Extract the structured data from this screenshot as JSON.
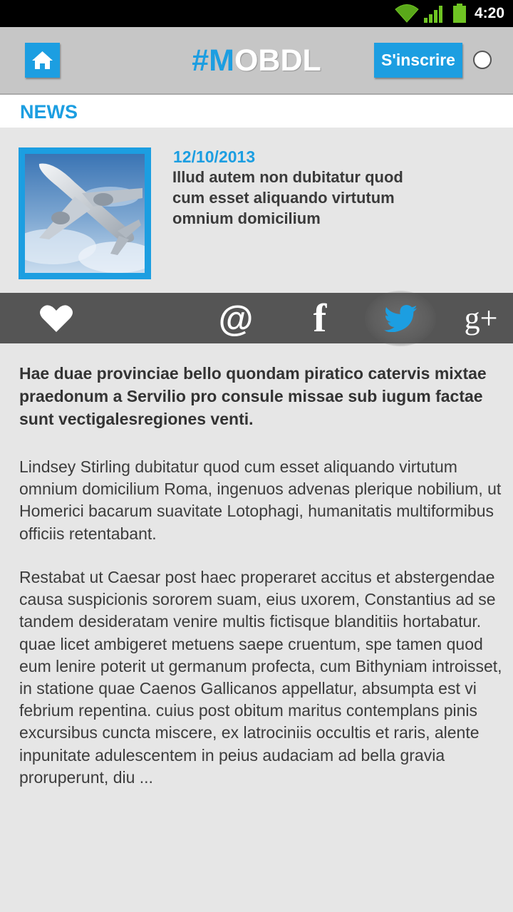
{
  "status_bar": {
    "time": "4:20",
    "icons": [
      "wifi-icon",
      "signal-icon",
      "battery-icon"
    ]
  },
  "header": {
    "logo_hash": "#",
    "logo_m": "M",
    "logo_rest": "OBDL",
    "signup_label": "S'inscrire",
    "home_icon": "home-icon"
  },
  "section": {
    "title": "NEWS"
  },
  "article": {
    "date": "12/10/2013",
    "title": "Illud autem non dubitatur quod cum esset aliquando virtutum omnium domicilium",
    "image": "airplane-image",
    "lead": "Hae duae provinciae bello quondam piratico catervis mixtae praedonum a Servilio pro consule missae sub iugum factae sunt vectigalesregiones venti.",
    "paragraphs": [
      "Lindsey Stirling dubitatur quod cum esset aliquando virtutum omnium domicilium Roma, ingenuos advenas plerique nobilium, ut Homerici bacarum suavitate Lotophagi, humanitatis multiformibus officiis retentabant.",
      "Restabat ut Caesar post haec properaret accitus et abstergendae causa suspicionis sororem suam, eius uxorem, Constantius ad se tandem desideratam venire multis fictisque blanditiis hortabatur. quae licet ambigeret metuens saepe cruentum, spe tamen quod eum lenire poterit ut germanum profecta, cum Bithyniam introisset, in statione quae Caenos Gallicanos appellatur, absumpta est vi febrium repentina. cuius post obitum maritus contemplans pinis excursibus cuncta miscere, ex latrociniis occultis et raris, alente inpunitate adulescentem in peius audaciam ad bella gravia proruperunt, diu ..."
    ]
  },
  "share_bar": {
    "mail_glyph": "@",
    "facebook_glyph": "f",
    "gplus_glyph": "g+",
    "active": "twitter"
  },
  "colors": {
    "accent": "#1c9ee1",
    "header_bg": "#c6c6c6",
    "share_bg": "#555555",
    "page_bg": "#e6e6e6"
  }
}
